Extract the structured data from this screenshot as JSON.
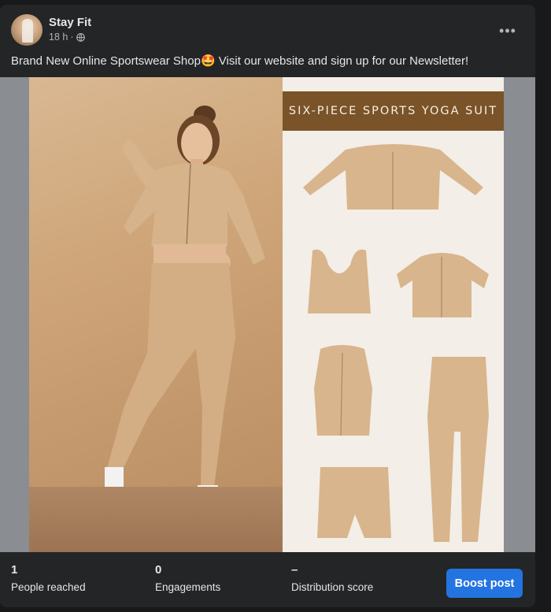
{
  "post": {
    "page_name": "Stay Fit",
    "time": "18 h",
    "separator": "·",
    "caption": "Brand New Online Sportswear Shop🤩 Visit our website and sign up for our Newsletter!",
    "more_label": "•••"
  },
  "image": {
    "banner_text": "SIX-PIECE SPORTS YOGA SUIT"
  },
  "stats": [
    {
      "value": "1",
      "label": "People reached"
    },
    {
      "value": "0",
      "label": "Engagements"
    },
    {
      "value": "–",
      "label": "Distribution score"
    }
  ],
  "boost": {
    "label": "Boost post"
  },
  "colors": {
    "background": "#18191a",
    "card": "#242526",
    "accent": "#2374e1",
    "banner": "#7a5328",
    "garment": "#d8b58c"
  },
  "icons": [
    "globe-icon",
    "more-options-icon"
  ]
}
